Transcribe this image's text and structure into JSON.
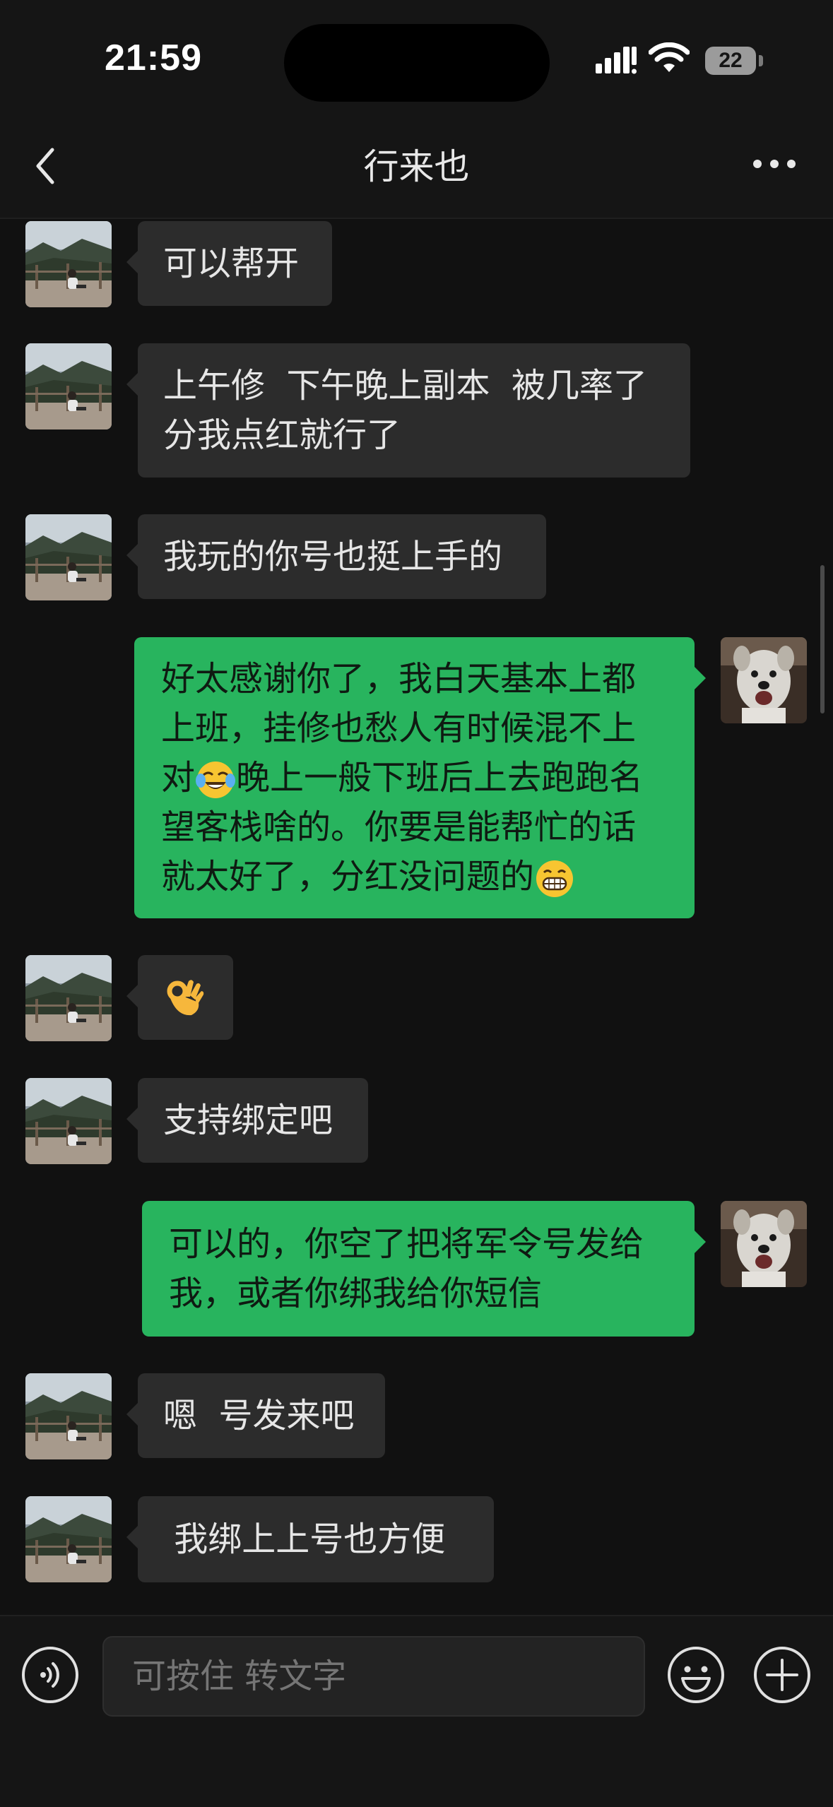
{
  "status_bar": {
    "time": "21:59",
    "battery": "22"
  },
  "header": {
    "title": "行来也"
  },
  "messages": [
    {
      "side": "in",
      "text": "可以帮开"
    },
    {
      "side": "in",
      "lines": [
        "上午修  下午晚上副本  被几率了",
        "分我点红就行了"
      ]
    },
    {
      "side": "in",
      "text": "我玩的你号也挺上手的"
    },
    {
      "side": "out",
      "lines": [
        "好太感谢你了，我白天基本上都",
        "上班，挂修也愁人有时候混不上",
        "晚上一般下班后上去跑跑名",
        "望客栈啥的。你要是能帮忙的话",
        "就太好了，分红没问题的"
      ],
      "line3_prefix": "对",
      "emojis": [
        "face-with-tears-of-joy",
        "grinning-face"
      ]
    },
    {
      "side": "in",
      "emoji": "ok-hand"
    },
    {
      "side": "in",
      "text": "支持绑定吧"
    },
    {
      "side": "out",
      "lines": [
        "可以的，你空了把将军令号发给",
        "我，或者你绑我给你短信"
      ]
    },
    {
      "side": "in",
      "text": "嗯  号发来吧"
    },
    {
      "side": "in",
      "text": " 我绑上上号也方便"
    }
  ],
  "input": {
    "placeholder": "可按住 转文字"
  },
  "colors": {
    "incoming_bubble": "#2c2c2c",
    "outgoing_bubble": "#28b45e",
    "background": "#111111"
  }
}
